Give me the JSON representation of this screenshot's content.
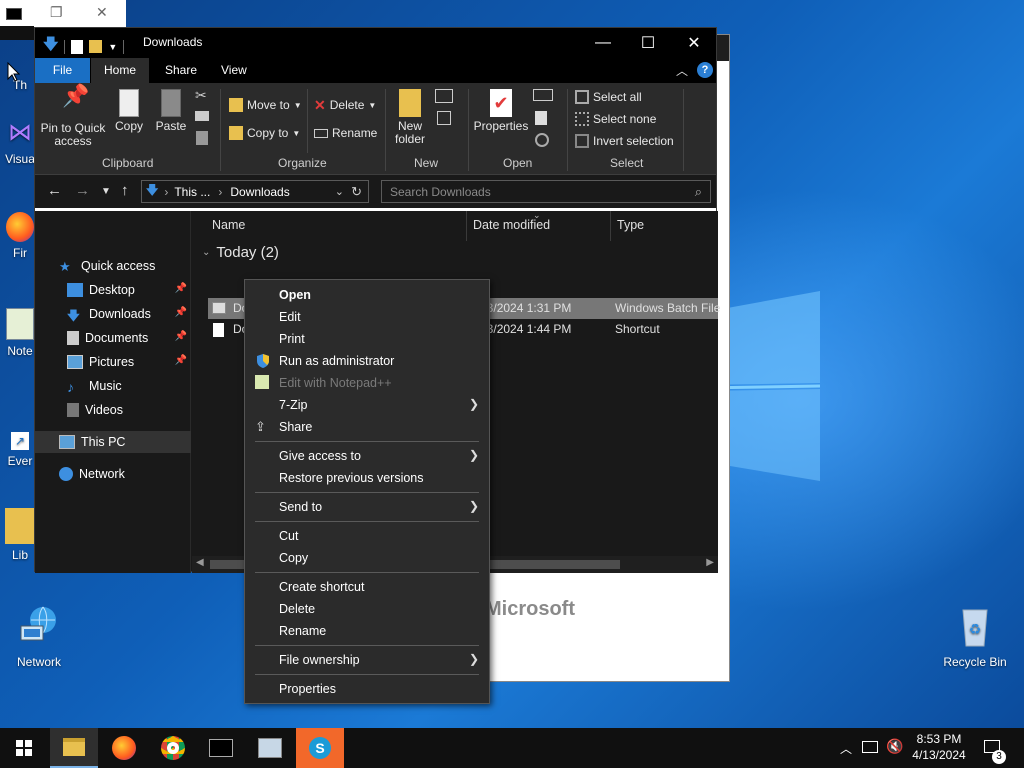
{
  "colors": {
    "accent": "#1a6fc4",
    "explorer_bg": "#191919",
    "ribbon_bg": "#2b2b2b",
    "menu_bg": "#2b2b2b",
    "taskbar_bg": "#101010"
  },
  "desktop": {
    "icons": [
      {
        "label": "Th",
        "icon": "file-icon"
      },
      {
        "label": "Visua",
        "icon": "visual-studio-icon"
      },
      {
        "label": "Fir",
        "icon": "firefox-shortcut-icon"
      },
      {
        "label": "Note",
        "icon": "notepad-icon"
      },
      {
        "label": "Ever",
        "icon": "shortcut-icon"
      },
      {
        "label": "Lib",
        "icon": "folder-icon"
      },
      {
        "label": "Network",
        "icon": "network-icon"
      },
      {
        "label": "Recycle Bin",
        "icon": "recycle-bin-icon"
      }
    ],
    "bg_window_text": "Microsoft"
  },
  "explorer": {
    "title": "Downloads",
    "controls": {
      "minimize": "—",
      "maximize": "☐",
      "close": "✕"
    },
    "tabs": [
      "File",
      "Home",
      "Share",
      "View"
    ],
    "ribbon": {
      "clipboard": {
        "label": "Clipboard",
        "pin": "Pin to Quick access",
        "copy": "Copy",
        "paste": "Paste"
      },
      "organize": {
        "label": "Organize",
        "move_to": "Move to",
        "copy_to": "Copy to",
        "delete": "Delete",
        "rename": "Rename"
      },
      "new": {
        "label": "New",
        "new_folder": "New folder"
      },
      "open": {
        "label": "Open",
        "properties": "Properties"
      },
      "select": {
        "label": "Select",
        "select_all": "Select all",
        "select_none": "Select none",
        "invert": "Invert selection"
      }
    },
    "address": {
      "crumb_1": "This ...",
      "crumb_2": "Downloads",
      "search_placeholder": "Search Downloads"
    },
    "nav": {
      "quick_access": "Quick access",
      "items": [
        "Desktop",
        "Downloads",
        "Documents",
        "Pictures",
        "Music",
        "Videos"
      ],
      "this_pc": "This PC",
      "network": "Network"
    },
    "columns": {
      "name": "Name",
      "date": "Date modified",
      "type": "Type"
    },
    "group": "Today (2)",
    "files": [
      {
        "name": "Do",
        "date": "4/13/2024 1:31 PM",
        "type": "Windows Batch File"
      },
      {
        "name": "Do",
        "date": "4/13/2024 1:44 PM",
        "type": "Shortcut"
      }
    ]
  },
  "context_menu": {
    "open": "Open",
    "edit": "Edit",
    "print": "Print",
    "run_admin": "Run as administrator",
    "edit_npp": "Edit with Notepad++",
    "seven_zip": "7-Zip",
    "share": "Share",
    "give_access": "Give access to",
    "restore": "Restore previous versions",
    "send_to": "Send to",
    "cut": "Cut",
    "copy": "Copy",
    "create_shortcut": "Create shortcut",
    "delete": "Delete",
    "rename": "Rename",
    "file_ownership": "File ownership",
    "properties": "Properties"
  },
  "taskbar": {
    "time": "8:53 PM",
    "date": "4/13/2024",
    "notifications": "3"
  }
}
